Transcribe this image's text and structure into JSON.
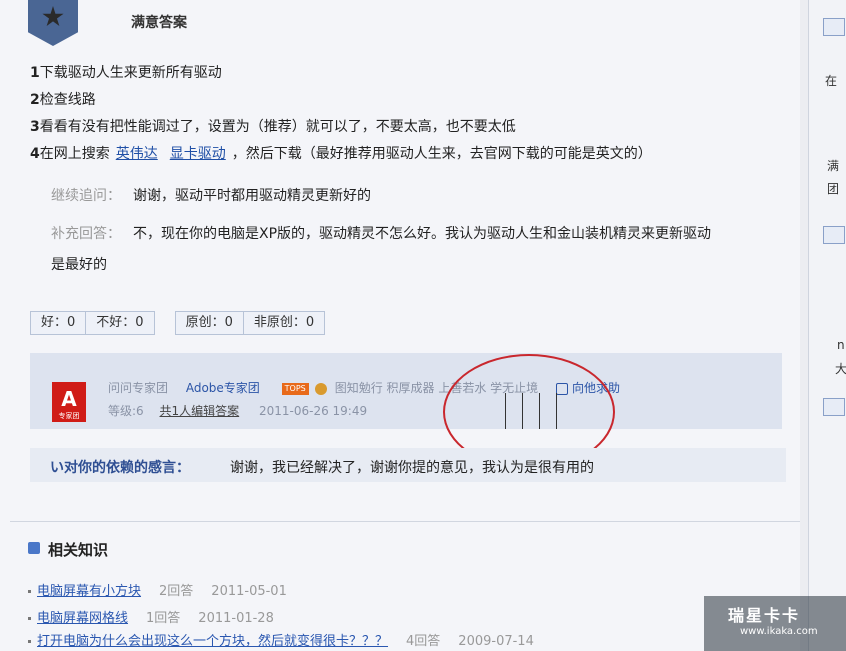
{
  "best_answer": {
    "title": "满意答案",
    "steps": [
      {
        "num": "1",
        "text": "下载驱动人生来更新所有驱动"
      },
      {
        "num": "2",
        "text": "检查线路"
      },
      {
        "num": "3",
        "text": "看看有没有把性能调过了，设置为（推荐）就可以了，不要太高，也不要太低"
      },
      {
        "num": "4",
        "pre": "在网上搜索",
        "link1": "英伟达",
        "link2": "显卡驱动",
        "post": "，然后下载（最好推荐用驱动人生来，去官网下载的可能是英文的）"
      }
    ]
  },
  "followup": {
    "label": "继续追问：",
    "text": "谢谢，驱动平时都用驱动精灵更新好的"
  },
  "supplement": {
    "label": "补充回答：",
    "text": "不，现在你的电脑是XP版的，驱动精灵不怎么好。我认为驱动人生和金山装机精灵来更新驱动",
    "text2": "是最好的"
  },
  "votes": {
    "good": "好：0",
    "bad": "不好：0",
    "original": "原创：0",
    "non_original": "非原创：0"
  },
  "expert": {
    "logo_letter": "A",
    "logo_sub": "专家团",
    "team": "问问专家团",
    "name": "Adobe专家团",
    "tops": "TOPS",
    "titles": "图知勉行  积厚成器  上善若水  学无止境",
    "help": "向他求助",
    "level": "等级:6",
    "editors": "共1人编辑答案",
    "time": "2011-06-26 19:49"
  },
  "thanks": {
    "label": "い对你的依赖的感言：",
    "text": "谢谢，我已经解决了，谢谢你提的意见，我认为是很有用的"
  },
  "related": {
    "title": "相关知识",
    "items": [
      {
        "title": "电脑屏幕有小方块",
        "answers": "2回答",
        "date": "2011-05-01"
      },
      {
        "title": "电脑屏幕网格线",
        "answers": "1回答",
        "date": "2011-01-28"
      },
      {
        "title": "打开电脑为什么会出现这么一个方块，然后就变得很卡？？？",
        "answers": "4回答",
        "date": "2009-07-14"
      }
    ]
  },
  "sidebar": {
    "t1": "在",
    "t2": "满",
    "t3": "团",
    "t4": "n",
    "t5": "大"
  },
  "watermark": {
    "main": "瑞星卡卡",
    "sub": "www.ikaka.com"
  }
}
